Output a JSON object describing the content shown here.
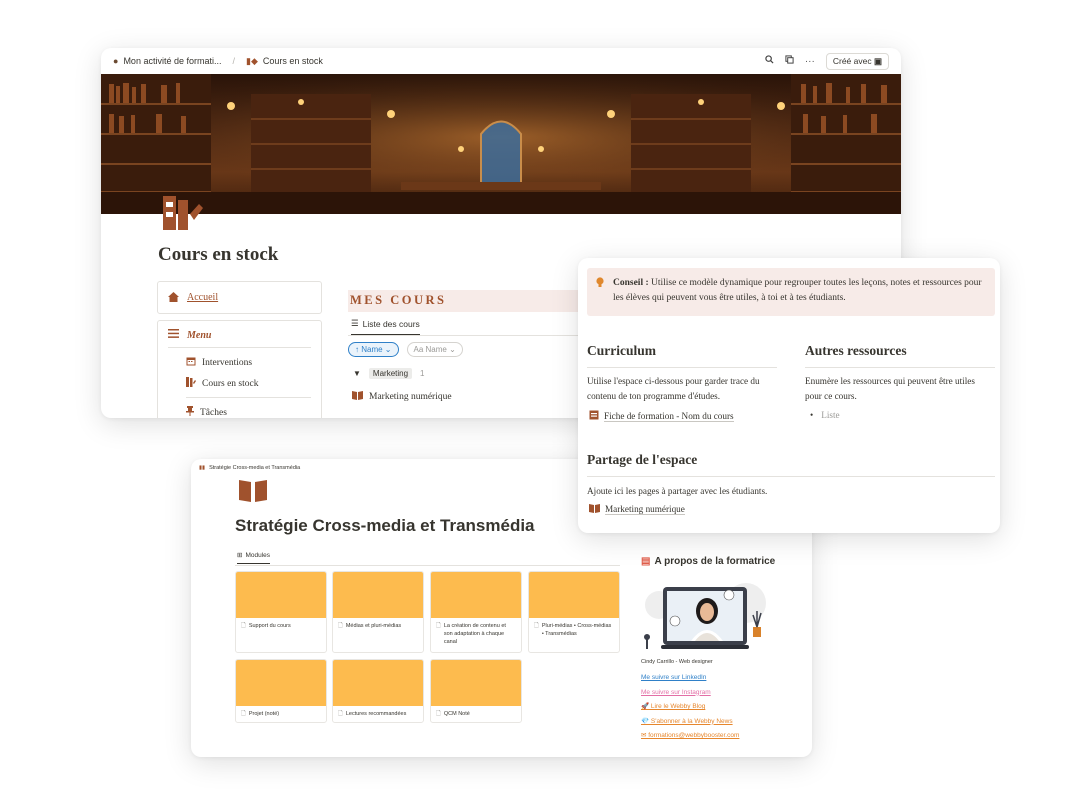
{
  "stock_page": {
    "breadcrumb": [
      "Mon activité de formati...",
      "Cours en stock"
    ],
    "created_label": "Créé avec",
    "title": "Cours en stock",
    "home_label": "Accueil",
    "menu_label": "Menu",
    "menu_items": [
      "Interventions",
      "Cours en stock",
      "Tâches"
    ],
    "section_heading": "MES COURS",
    "view_tab": "Liste des cours",
    "filter_sort": "Name",
    "filter_other": "Name",
    "group_tag": "Marketing",
    "group_count": "1",
    "course_item": "Marketing numérique"
  },
  "strategy_page": {
    "breadcrumb": "Stratégie Cross-media et Transmédia",
    "title": "Stratégie Cross-media et Transmédia",
    "view_tab": "Modules",
    "modules": [
      "Support du cours",
      "Médias et pluri-médias",
      "La création de contenu et son adaptation à chaque canal",
      "Pluri-médias • Cross-médias • Transmédias",
      "Projet (noté)",
      "Lectures recommandées",
      "QCM Noté"
    ],
    "about_title": "A propos de la formatrice",
    "about_caption": "Cindy Carrillo - Web designer",
    "links": [
      {
        "text": "Me suivre sur LinkedIn",
        "color": "#2f80c8"
      },
      {
        "text": "Me suivre sur Instagram",
        "color": "#e36fa6"
      },
      {
        "text": "🚀 Lire le Webby Blog",
        "color": "#e6862c"
      },
      {
        "text": "💎 S'abonner à la Webby News",
        "color": "#e6862c"
      },
      {
        "text": "✉ formations@webbybooster.com",
        "color": "#e6862c"
      }
    ],
    "tile_color": "#fdbb4e"
  },
  "conseil_page": {
    "callout_bold": "Conseil :",
    "callout_text": " Utilise ce modèle dynamique pour regrouper toutes les leçons, notes et ressources pour les élèves qui peuvent vous être utiles, à toi et à tes étudiants.",
    "curriculum_title": "Curriculum",
    "curriculum_text": "Utilise l'espace ci-dessous pour garder trace du contenu de ton programme d'études.",
    "curriculum_link": "Fiche de formation - Nom du cours",
    "resources_title": "Autres ressources",
    "resources_text": "Enumère les ressources qui peuvent être utiles pour ce cours.",
    "resources_bullet": "Liste",
    "share_title": "Partage de l'espace",
    "share_text": "Ajoute ici les pages à partager avec les étudiants.",
    "share_link": "Marketing numérique"
  },
  "colors": {
    "accent": "#a0522d",
    "callout_bg": "#f7ebe8",
    "link_blue": "#2f80c8"
  }
}
